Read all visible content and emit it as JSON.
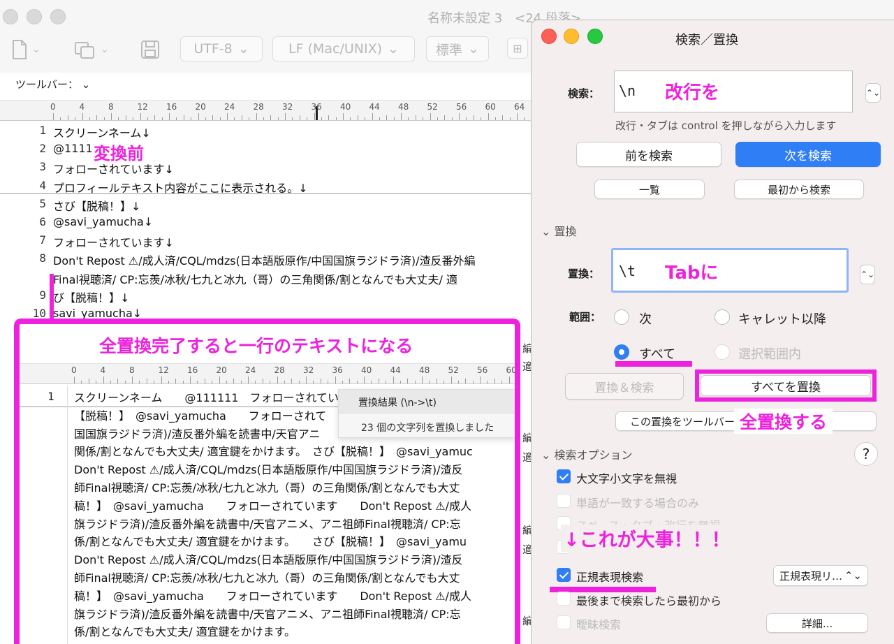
{
  "window": {
    "title": "名称未設定 3　<24 段落>",
    "toolbar": {
      "encoding": "UTF-8",
      "line_ending": "LF (Mac/UNIX)",
      "style": "標準",
      "label": "ツールバー：",
      "new_icon": "document-icon",
      "copy_icon": "copy-icon",
      "save_icon": "save-icon"
    },
    "ruler_ticks": [
      "0",
      "4",
      "8",
      "12",
      "16",
      "20",
      "24",
      "28",
      "32",
      "36",
      "40",
      "44",
      "48",
      "52",
      "56",
      "60",
      "64"
    ]
  },
  "editor": {
    "lines": [
      {
        "num": "1",
        "text": "スクリーンネーム↓"
      },
      {
        "num": "2",
        "text": "@1111"
      },
      {
        "num": "3",
        "text": "フォローされています↓"
      },
      {
        "num": "4",
        "text": "プロフィールテキスト内容がここに表示される。↓"
      },
      {
        "num": "5",
        "text": "さび【脱稿！】↓"
      },
      {
        "num": "6",
        "text": "@savi_yamucha↓"
      },
      {
        "num": "7",
        "text": "フォローされています↓"
      },
      {
        "num": "8",
        "text": "Don't Repost ⚠/成人済/CQL/mdzs(日本語版原作/中国国旗ラジドラ済)/渣反番外編"
      },
      {
        "num": "",
        "text": "Final視聴済/ CP:忘羨/冰秋/七九と冰九（哥）の三角関係/割となんでも大丈夫/ 適"
      },
      {
        "num": "9",
        "text": "び【脱稿！】↓"
      },
      {
        "num": "10",
        "text": "savi_yamucha↓"
      }
    ],
    "annotation_before": "変換前"
  },
  "result": {
    "annotation": "全置換完了すると一行のテキストになる",
    "ruler_ticks": [
      "0",
      "4",
      "8",
      "12",
      "16",
      "20",
      "24",
      "28",
      "32",
      "36",
      "40",
      "44",
      "48",
      "52",
      "56",
      "60"
    ],
    "line_num": "1",
    "lines": [
      "スクリーンネーム　　@111111　フォローされてい",
      "【脱稿！】　@savi_yamucha　　フォローされて",
      "国国旗ラジドラ済)/渣反番外編を読書中/天官アニ",
      "関係/割となんでも大丈夫/ 適宜鍵をかけます。　さび【脱稿！】　@savi_yamuc",
      "Don't Repost ⚠/成人済/CQL/mdzs(日本語版原作/中国国旗ラジドラ済)/渣反",
      "師Final視聴済/ CP:忘羨/冰秋/七九と冰九（哥）の三角関係/割となんでも大丈",
      "稿！】　@savi_yamucha　　フォローされています　　Don't Repost ⚠/成人",
      "旗ラジドラ済)/渣反番外編を読書中/天官アニメ、アニ祖師Final視聴済/ CP:忘",
      "係/割となんでも大丈夫/ 適宜鍵をかけます。　　さび【脱稿！】　@savi_yamu",
      "Don't Repost ⚠/成人済/CQL/mdzs(日本語版原作/中国国旗ラジドラ済)/渣反",
      "師Final視聴済/ CP:忘羨/冰秋/七九と冰九（哥）の三角関係/割となんでも大丈",
      "稿！】　@savi_yamucha　　フォローされています　　Don't Repost ⚠/成人",
      "旗ラジドラ済)/渣反番外編を読書中/天官アニメ、アニ祖師Final視聴済/ CP:忘",
      "係/割となんでも大丈夫/ 適宜鍵をかけます。"
    ],
    "popup_title": "置換結果 (\\n->\\t)",
    "popup_message": "23 個の文字列を置換しました",
    "edge_labels": [
      "編",
      "適",
      "編",
      "適",
      "編",
      "適",
      "編"
    ]
  },
  "panel": {
    "title": "検索／置換",
    "find_label": "検索：",
    "find_value": "\\n",
    "find_annotation": "改行を",
    "find_hint": "改行・タブは control を押しながら入力します",
    "prev_button": "前を検索",
    "next_button": "次を検索",
    "list_button": "一覧",
    "from_start_button": "最初から検索",
    "replace_section": "置換",
    "replace_label": "置換：",
    "replace_value": "\\t",
    "replace_annotation": "Tabに",
    "range_label": "範囲：",
    "range_next": "次",
    "range_after_caret": "キャレット以降",
    "range_all": "すべて",
    "range_selection": "選択範囲内",
    "replace_find_button": "置換＆検索",
    "replace_all_button": "すべてを置換",
    "toolbar_add_button": "この置換をツールバーに追加する",
    "replace_all_annotation": "全置換する",
    "options_section": "検索オプション",
    "help": "?",
    "opt_ignore_case": "大文字小文字を無視",
    "opt_whole_word": "単語が一致する場合のみ",
    "opt_space": "スペース・タブ・改行を無視",
    "opt_hidden": "",
    "opt_regex": "正規表現検索",
    "opt_wrap": "最後まで検索したら最初から",
    "opt_fuzzy": "曖昧検索",
    "regex_select": "正規表現リ…",
    "detail_button": "詳細...",
    "important_annotation": "↓これが大事！！！",
    "accent_color": "#2f7ef6",
    "annotation_color": "#ee22dd"
  }
}
